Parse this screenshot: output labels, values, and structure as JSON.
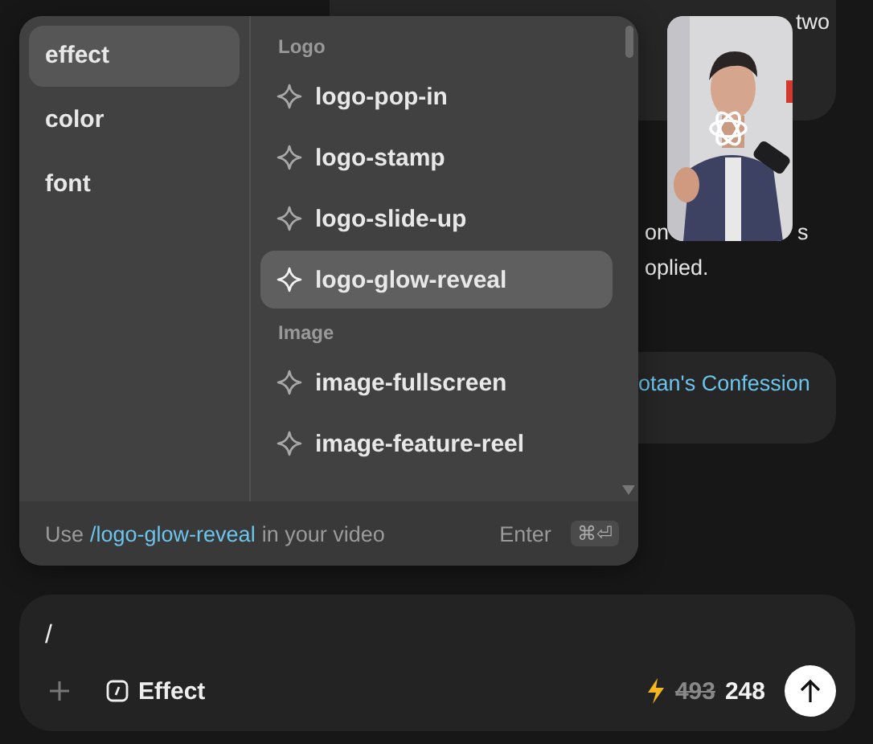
{
  "chat": {
    "bubble_1": {
      "text": "two"
    },
    "paragraph": {
      "line_1": [
        "on",
        "s"
      ],
      "line_2": "oplied."
    },
    "bubble_2": {
      "link": "otan's Confession"
    }
  },
  "command_menu": {
    "categories": [
      {
        "label": "effect",
        "selected": true
      },
      {
        "label": "color",
        "selected": false
      },
      {
        "label": "font",
        "selected": false
      }
    ],
    "groups": [
      {
        "heading": "Logo",
        "items": [
          {
            "label": "logo-pop-in",
            "selected": false
          },
          {
            "label": "logo-stamp",
            "selected": false
          },
          {
            "label": "logo-slide-up",
            "selected": false
          },
          {
            "label": "logo-glow-reveal",
            "selected": true
          }
        ]
      },
      {
        "heading": "Image",
        "items": [
          {
            "label": "image-fullscreen",
            "selected": false
          },
          {
            "label": "image-feature-reel",
            "selected": false
          }
        ]
      }
    ],
    "footer": {
      "prefix": "Use",
      "command": "/logo-glow-reveal",
      "suffix": "in your video",
      "key_hint": "Enter",
      "shortcut": "⌘⏎"
    }
  },
  "composer": {
    "value": "/",
    "mode": "Effect",
    "old_credits": "493",
    "credits": "248"
  }
}
